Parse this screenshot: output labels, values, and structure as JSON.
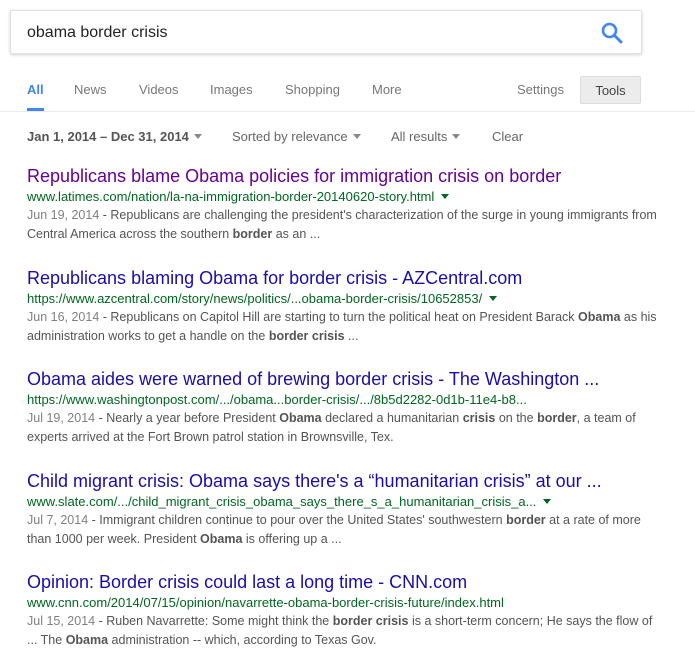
{
  "search": {
    "query": "obama border crisis"
  },
  "tabs": {
    "items": [
      "All",
      "News",
      "Videos",
      "Images",
      "Shopping",
      "More"
    ],
    "settings": "Settings",
    "tools": "Tools"
  },
  "filters": {
    "date_range": "Jan 1, 2014 – Dec 31, 2014",
    "sort": "Sorted by relevance",
    "results": "All results",
    "clear": "Clear"
  },
  "results": [
    {
      "title": "Republicans blame Obama policies for immigration crisis on border",
      "url": "www.latimes.com/nation/la-na-immigration-border-20140620-story.html",
      "date": "Jun 19, 2014",
      "snippet": [
        {
          "t": "Republicans are challenging the president's characterization of the surge in young immigrants from Central America across the southern "
        },
        {
          "b": "border"
        },
        {
          "t": " as an ..."
        }
      ]
    },
    {
      "title": "Republicans blaming Obama for border crisis - AZCentral.com",
      "url": "https://www.azcentral.com/story/news/politics/...obama-border-crisis/10652853/",
      "date": "Jun 16, 2014",
      "snippet": [
        {
          "t": "Republicans on Capitol Hill are starting to turn the political heat on President Barack "
        },
        {
          "b": "Obama"
        },
        {
          "t": " as his administration works to get a handle on the "
        },
        {
          "b": "border crisis"
        },
        {
          "t": " ..."
        }
      ]
    },
    {
      "title": "Obama aides were warned of brewing border crisis - The Washington ...",
      "url": "https://www.washingtonpost.com/.../obama...border-crisis/.../8b5d2282-0d1b-11e4-b8...",
      "date": "Jul 19, 2014",
      "snippet": [
        {
          "t": "Nearly a year before President "
        },
        {
          "b": "Obama"
        },
        {
          "t": " declared a humanitarian "
        },
        {
          "b": "crisis"
        },
        {
          "t": " on the "
        },
        {
          "b": "border"
        },
        {
          "t": ", a team of experts arrived at the Fort Brown patrol station in Brownsville, Tex."
        }
      ]
    },
    {
      "title": "Child migrant crisis: Obama says there's a “humanitarian crisis” at our ...",
      "url": "www.slate.com/.../child_migrant_crisis_obama_says_there_s_a_humanitarian_crisis_a...",
      "date": "Jul 7, 2014",
      "snippet": [
        {
          "t": "Immigrant children continue to pour over the United States' southwestern "
        },
        {
          "b": "border"
        },
        {
          "t": " at a rate of more than 1000 per week. President "
        },
        {
          "b": "Obama"
        },
        {
          "t": " is offering up a ..."
        }
      ]
    },
    {
      "title": "Opinion: Border crisis could last a long time - CNN.com",
      "url": "www.cnn.com/2014/07/15/opinion/navarrette-obama-border-crisis-future/index.html",
      "date": "Jul 15, 2014",
      "snippet": [
        {
          "t": "Ruben Navarrette: Some might think the "
        },
        {
          "b": "border crisis"
        },
        {
          "t": " is a short-term concern; He says the flow of ... The "
        },
        {
          "b": "Obama"
        },
        {
          "t": " administration -- which, according to Texas Gov."
        }
      ]
    }
  ],
  "colors": {
    "link": "#1a0dab",
    "visited": "#609",
    "url": "#006621",
    "accent": "#4285f4"
  }
}
